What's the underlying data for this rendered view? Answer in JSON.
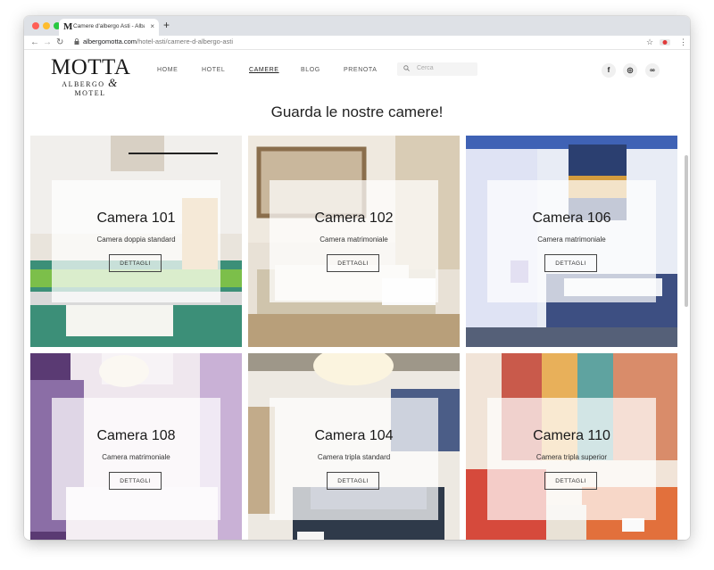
{
  "browser": {
    "tab_title": "Camere d'albergo Asti - Alba",
    "tab_favicon": "M",
    "tab_close": "×",
    "new_tab": "+",
    "url_domain": "albergomotta.com",
    "url_path": "/hotel-asti/camere-d-albergo-asti",
    "back_icon": "←",
    "forward_icon": "→",
    "reload_icon": "↻",
    "star_icon": "☆",
    "menu_icon": "⋮"
  },
  "site": {
    "logo_main": "MOTTA",
    "logo_sub_left": "ALBERGO",
    "logo_amp": "&",
    "logo_sub_right": "MOTEL",
    "nav": [
      "HOME",
      "HOTEL",
      "CAMERE",
      "BLOG",
      "PRENOTA"
    ],
    "active_nav": "CAMERE",
    "search_placeholder": "Cerca",
    "social": [
      "f",
      "◎",
      "∞"
    ],
    "heading": "Guarda le nostre camere!"
  },
  "rooms": [
    {
      "name": "Camera 101",
      "type": "Camera doppia standard",
      "button": "DETTAGLI"
    },
    {
      "name": "Camera 102",
      "type": "Camera matrimoniale",
      "button": "DETTAGLI"
    },
    {
      "name": "Camera 106",
      "type": "Camera matrimoniale",
      "button": "DETTAGLI"
    },
    {
      "name": "Camera 108",
      "type": "Camera matrimoniale",
      "button": "DETTAGLI"
    },
    {
      "name": "Camera 104",
      "type": "Camera tripla standard",
      "button": "DETTAGLI"
    },
    {
      "name": "Camera 110",
      "type": "Camera tripla superior",
      "button": "DETTAGLI"
    }
  ]
}
